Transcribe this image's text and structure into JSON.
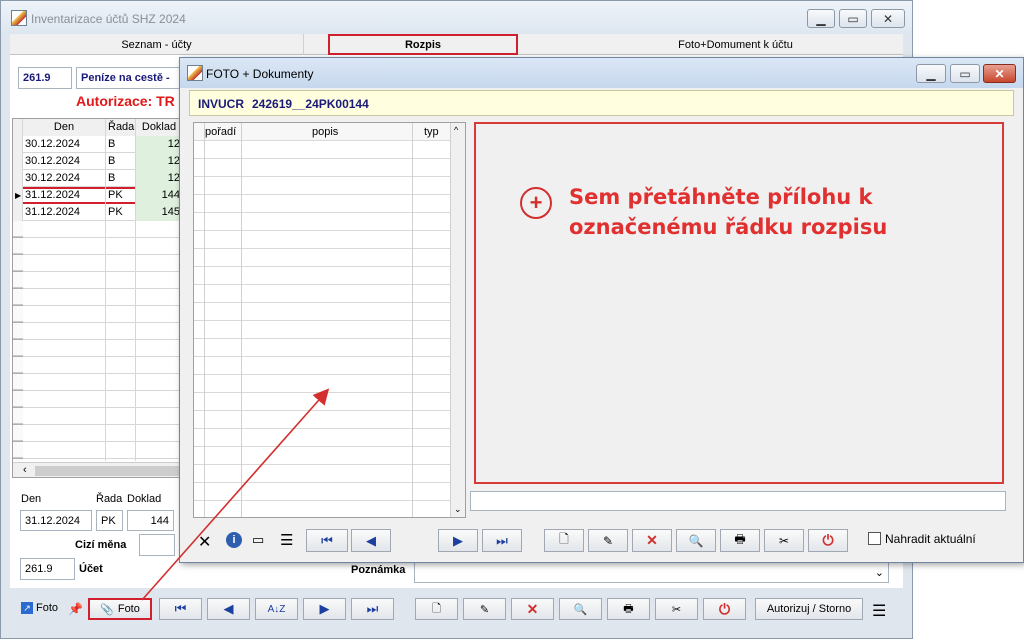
{
  "main_window": {
    "title": "Inventarizace účtů SHZ 2024",
    "tabs": [
      "Seznam - účty",
      "Rozpis",
      "Foto+Domument k účtu"
    ],
    "account_number": "261.9",
    "account_name": "Peníze na cestě -",
    "authorization_text": "Autorizace: TR",
    "grid": {
      "headers": [
        "Den",
        "Řada",
        "Doklad"
      ],
      "rows": [
        {
          "den": "30.12.2024",
          "rada": "B",
          "doklad": "12"
        },
        {
          "den": "30.12.2024",
          "rada": "B",
          "doklad": "12"
        },
        {
          "den": "30.12.2024",
          "rada": "B",
          "doklad": "12"
        },
        {
          "den": "31.12.2024",
          "rada": "PK",
          "doklad": "144"
        },
        {
          "den": "31.12.2024",
          "rada": "PK",
          "doklad": "145"
        }
      ]
    },
    "form": {
      "den_label": "Den",
      "rada_label": "Řada",
      "doklad_label": "Doklad",
      "den_value": "31.12.2024",
      "rada_value": "PK",
      "doklad_value": "144",
      "cizi_mena_label": "Cizí měna",
      "ucet_value": "261.9",
      "ucet_label": "Účet",
      "poznamka_label": "Poznámka"
    },
    "toolbar": {
      "foto_link": "Foto",
      "foto_button": "Foto",
      "autorizuj_button": "Autorizuj / Storno"
    }
  },
  "dialog": {
    "title": "FOTO + Dokumenty",
    "header_code": "INVUCR",
    "header_doc": "242619__24PK00144",
    "grid_headers": [
      "pořadí",
      "popis",
      "typ"
    ],
    "drop_text_line1": "Sem přetáhněte přílohu k",
    "drop_text_line2": "označenému řádku rozpisu",
    "replace_label": "Nahradit aktuální"
  },
  "colors": {
    "accent_red": "#d32f2f",
    "header_blue": "#1a1a7a",
    "doklad_green": "#dff0df"
  }
}
